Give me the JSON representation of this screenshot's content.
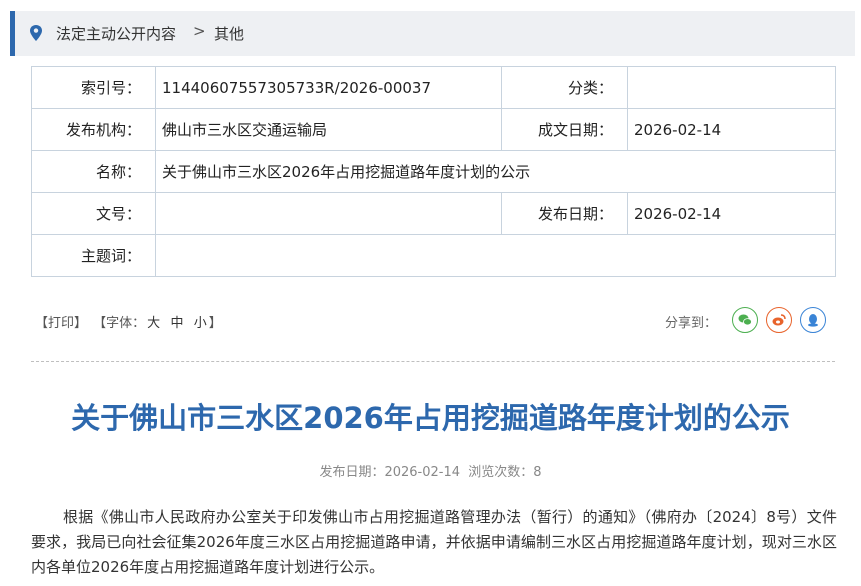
{
  "breadcrumb": {
    "items": [
      "法定主动公开内容",
      "其他"
    ],
    "separator": ">"
  },
  "meta": {
    "index_label": "索引号：",
    "index_value": "11440607557305733R/2026-00037",
    "category_label": "分类：",
    "category_value": "",
    "publisher_label": "发布机构：",
    "publisher_value": "佛山市三水区交通运输局",
    "written_date_label": "成文日期：",
    "written_date_value": "2026-02-14",
    "name_label": "名称：",
    "name_value": "关于佛山市三水区2026年占用挖掘道路年度计划的公示",
    "doc_no_label": "文号：",
    "doc_no_value": "",
    "publish_date_label": "发布日期：",
    "publish_date_value": "2026-02-14",
    "topic_label": "主题词：",
    "topic_value": ""
  },
  "tools": {
    "print": "【打印】",
    "font_prefix": "【字体：",
    "font_large": "大",
    "font_medium": "中",
    "font_small": "小",
    "font_suffix": "】",
    "share_label": "分享到："
  },
  "share_icons": [
    {
      "name": "wechat-icon",
      "color": "#4caf50"
    },
    {
      "name": "weibo-icon",
      "color": "#e8632b"
    },
    {
      "name": "qq-icon",
      "color": "#3a84d6"
    }
  ],
  "article": {
    "title": "关于佛山市三水区2026年占用挖掘道路年度计划的公示",
    "info": "发布日期：2026-02-14  浏览次数：8",
    "paragraph": "根据《佛山市人民政府办公室关于印发佛山市占用挖掘道路管理办法（暂行）的通知》（佛府办〔2024〕8号）文件要求，我局已向社会征集2026年度三水区占用挖掘道路申请，并依据申请编制三水区占用挖掘道路年度计划，现对三水区内各单位2026年度占用挖掘道路年度计划进行公示。"
  },
  "colors": {
    "accent": "#2d68ad",
    "breadcrumb_bg": "#eef0f3",
    "table_border": "#c8d3de"
  }
}
